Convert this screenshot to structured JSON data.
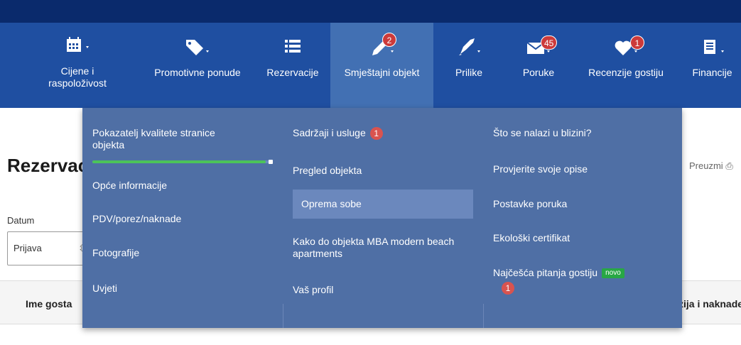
{
  "nav": {
    "items": [
      {
        "label": "Cijene i raspoloživost",
        "icon": "calendar-icon"
      },
      {
        "label": "Promotivne ponude",
        "icon": "tag-icon"
      },
      {
        "label": "Rezervacije",
        "icon": "list-icon"
      },
      {
        "label": "Smještajni objekt",
        "icon": "pencil-icon",
        "badge": "2"
      },
      {
        "label": "Prilike",
        "icon": "rocket-icon"
      },
      {
        "label": "Poruke",
        "icon": "envelope-icon",
        "badge": "45"
      },
      {
        "label": "Recenzije gostiju",
        "icon": "heart-icon",
        "badge": "1"
      },
      {
        "label": "Financije",
        "icon": "document-icon"
      }
    ],
    "active": "Smještajni objekt"
  },
  "page": {
    "title": "Rezervaci",
    "datum_label": "Datum",
    "select_value": "Prijava",
    "preuzmi": "Preuzmi",
    "table": {
      "col_guest": "Ime gosta",
      "col_fees": "zija i naknade"
    }
  },
  "dropdown": {
    "col1": [
      {
        "label": "Pokazatelj kvalitete stranice objekta",
        "progress": 0.97
      },
      {
        "label": "Opće informacije"
      },
      {
        "label": "PDV/porez/naknade"
      },
      {
        "label": "Fotografije"
      },
      {
        "label": "Uvjeti"
      }
    ],
    "col2": [
      {
        "label": "Sadržaji i usluge",
        "badge": "1"
      },
      {
        "label": "Pregled objekta"
      },
      {
        "label": "Oprema sobe",
        "highlighted": true
      },
      {
        "label": "Kako do objekta MBA modern beach apartments"
      },
      {
        "label": "Vaš profil"
      }
    ],
    "col3": [
      {
        "label": "Što se nalazi u blizini?"
      },
      {
        "label": "Provjerite svoje opise"
      },
      {
        "label": "Postavke poruka"
      },
      {
        "label": "Ekološki certifikat"
      },
      {
        "label": "Najčešća pitanja gostiju",
        "tag": "novo",
        "badge": "1"
      }
    ]
  },
  "colors": {
    "nav_bg": "#1f4fa1",
    "top_strip": "#0a2a6c",
    "dropdown_bg": "#4f6fa5",
    "active_tab": "#4270b3",
    "badge_red": "#cc3a3a",
    "progress_green": "#4cc35a",
    "novo_green": "#28a745"
  }
}
